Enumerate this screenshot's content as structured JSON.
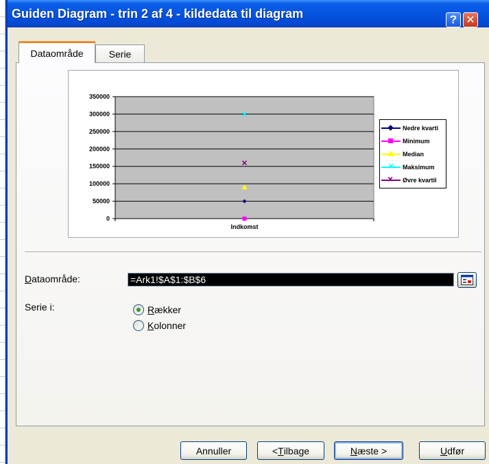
{
  "window": {
    "title": "Guiden Diagram - trin 2 af 4 - kildedata til diagram",
    "help_label": "?",
    "close_label": "✕"
  },
  "tabs": [
    {
      "label": "Dataområde",
      "active": true
    },
    {
      "label": "Serie",
      "active": false
    }
  ],
  "chart_data": {
    "type": "line",
    "categories": [
      "Indkomst"
    ],
    "ylim": [
      0,
      350000
    ],
    "yticks": [
      "350000",
      "300000",
      "250000",
      "200000",
      "150000",
      "100000",
      "50000",
      "0"
    ],
    "grid": true,
    "legend_position": "right",
    "series": [
      {
        "name": "Nedre kvartil",
        "values": [
          50000
        ],
        "color": "#000080",
        "marker": "diamond"
      },
      {
        "name": "Minimum",
        "values": [
          0
        ],
        "color": "#ff00ff",
        "marker": "square"
      },
      {
        "name": "Median",
        "values": [
          90000
        ],
        "color": "#ffff00",
        "marker": "triangle"
      },
      {
        "name": "Maksimum",
        "values": [
          300000
        ],
        "color": "#00ffff",
        "marker": "x"
      },
      {
        "name": "Øvre kvartil",
        "values": [
          160000
        ],
        "color": "#800080",
        "marker": "star"
      }
    ],
    "legend_labels": [
      "Nedre kvarti",
      "Minimum",
      "Median",
      "Maksimum",
      "Øvre kvartil"
    ]
  },
  "form": {
    "range_label_underlined": "D",
    "range_label_rest": "ataområde:",
    "range_value": "=Ark1!$A$1:$B$6",
    "series_in_label": "Serie i:",
    "radio_rows_underlined": "R",
    "radio_rows_rest": "ækker",
    "radio_rows_selected": true,
    "radio_cols_underlined": "K",
    "radio_cols_rest": "olonner",
    "radio_cols_selected": false
  },
  "buttons": {
    "cancel": "Annuller",
    "back_prefix": "< ",
    "back_underlined": "T",
    "back_rest": "ilbage",
    "next_underlined": "N",
    "next_rest": "æste >",
    "finish_underlined": "U",
    "finish_rest": "dfør"
  }
}
